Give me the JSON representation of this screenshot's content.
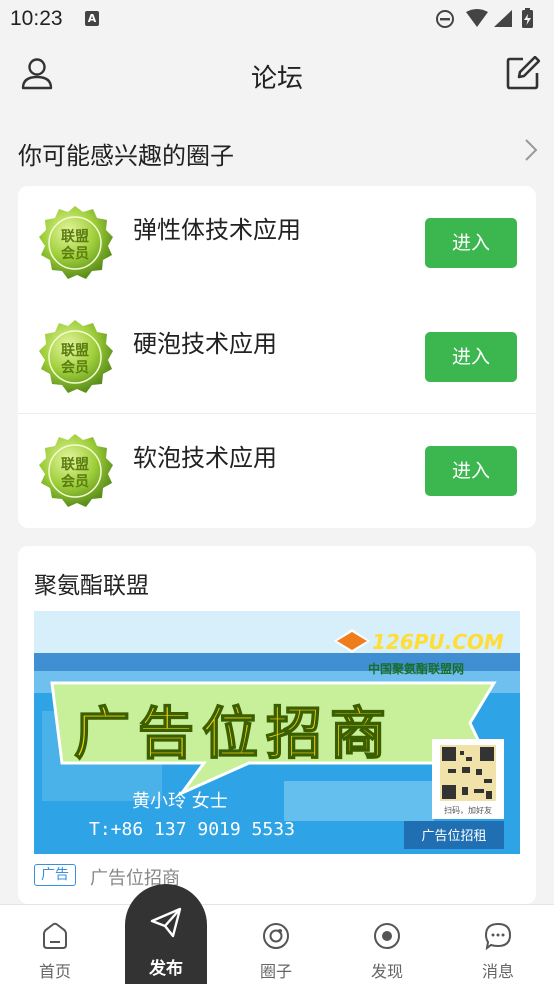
{
  "status_bar": {
    "time": "10:23",
    "notification_badge": "A"
  },
  "header": {
    "title": "论坛"
  },
  "recommended": {
    "heading": "你可能感兴趣的圈子",
    "badge_text_line1": "联盟",
    "badge_text_line2": "会员",
    "items": [
      {
        "name": "弹性体技术应用",
        "button": "进入"
      },
      {
        "name": "硬泡技术应用",
        "button": "进入"
      },
      {
        "name": "软泡技术应用",
        "button": "进入"
      }
    ]
  },
  "ad_card": {
    "title": "聚氨酯联盟",
    "banner": {
      "headline": "广告位招商",
      "contact_name": "黄小玲   女士",
      "phone": "T:+86 137 9019 5533",
      "brand": "126PU.COM",
      "brand_sub": "中国聚氨酯联盟网",
      "qr_caption": "扫码，加好友",
      "corner_button": "广告位招租"
    },
    "tag": "广告",
    "label": "广告位招商"
  },
  "tab_bar": {
    "items": [
      {
        "label": "首页",
        "icon": "home-icon"
      },
      {
        "label": "发布",
        "icon": "send-icon"
      },
      {
        "label": "圈子",
        "icon": "circle-icon"
      },
      {
        "label": "发现",
        "icon": "discover-icon"
      },
      {
        "label": "消息",
        "icon": "message-icon"
      }
    ]
  },
  "colors": {
    "accent_green": "#3cb64f",
    "ad_blue": "#2d9ee0",
    "dark": "#333333"
  }
}
